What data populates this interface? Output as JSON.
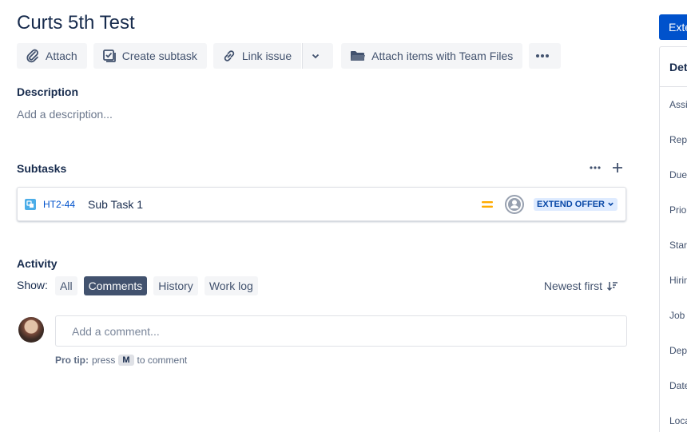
{
  "issue": {
    "title": "Curts 5th Test"
  },
  "toolbar": {
    "attach": "Attach",
    "create_subtask": "Create subtask",
    "link_issue": "Link issue",
    "team_files": "Attach items with Team Files"
  },
  "description": {
    "heading": "Description",
    "placeholder": "Add a description..."
  },
  "subtasks": {
    "heading": "Subtasks",
    "items": [
      {
        "key": "HT2-44",
        "summary": "Sub Task 1",
        "priority_icon": "medium-priority-icon",
        "status": "EXTEND OFFER"
      }
    ]
  },
  "activity": {
    "heading": "Activity",
    "show_label": "Show:",
    "filters": [
      {
        "label": "All",
        "active": false
      },
      {
        "label": "Comments",
        "active": true
      },
      {
        "label": "History",
        "active": false
      },
      {
        "label": "Work log",
        "active": false
      }
    ],
    "sort_label": "Newest first",
    "comment_placeholder": "Add a comment...",
    "protip": {
      "prefix": "Pro tip:",
      "press": "press",
      "key": "M",
      "suffix": "to comment"
    }
  },
  "sidebar": {
    "primary_button": "Exte",
    "details_heading": "Det",
    "fields": [
      "Assig",
      "Repo",
      "Due",
      "Prior",
      "Start",
      "Hirin",
      "Job r",
      "Depa",
      "Date",
      "Loca"
    ]
  },
  "colors": {
    "brand": "#0052cc",
    "priority": "#ffab00",
    "active_filter": "#42526e",
    "lozenge_bg": "#deebff"
  }
}
